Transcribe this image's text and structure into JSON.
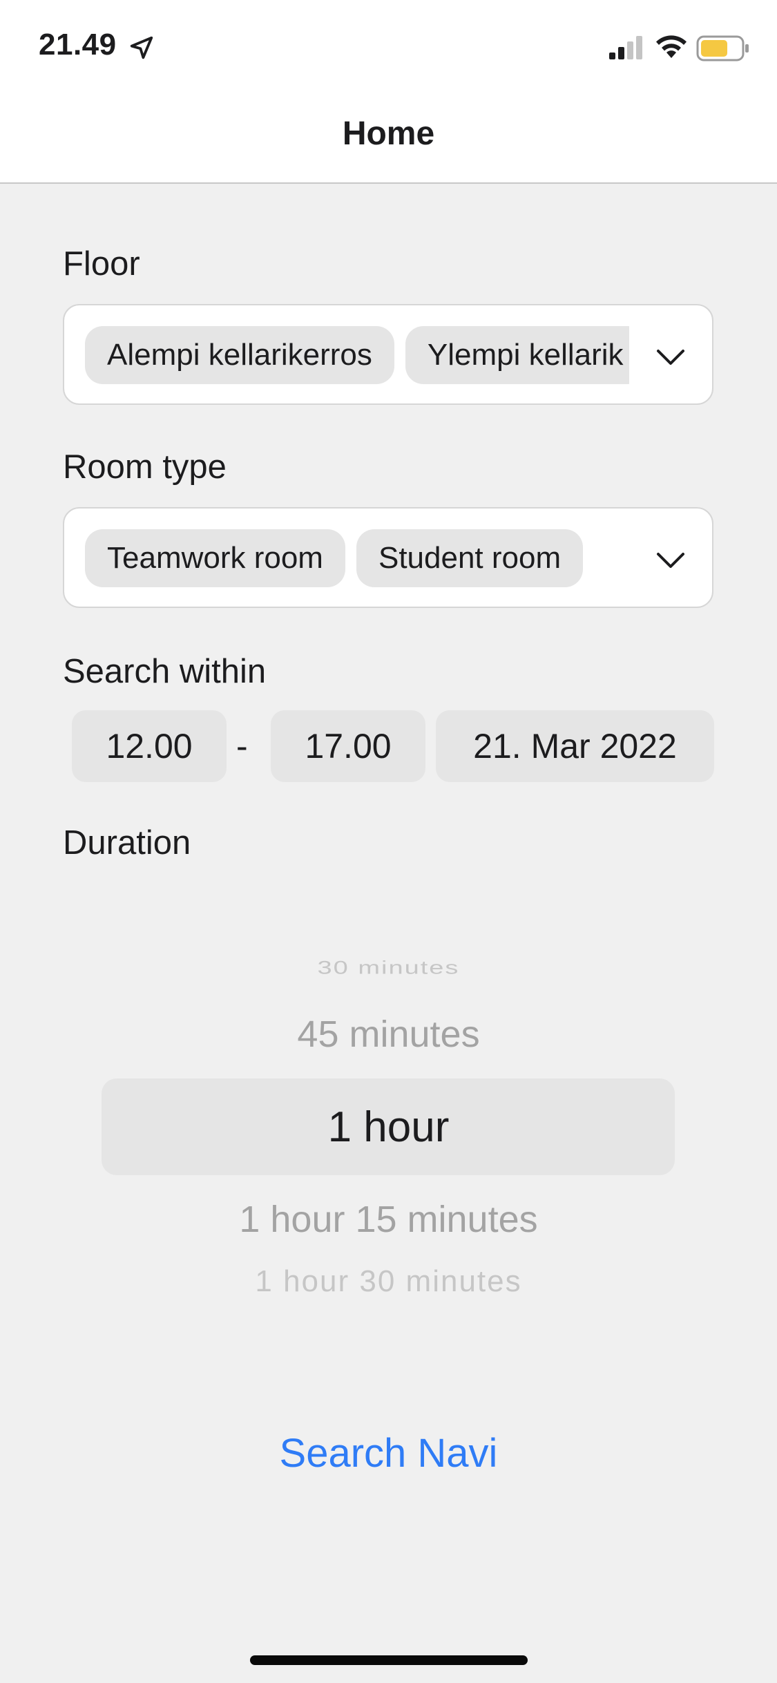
{
  "status_bar": {
    "time": "21.49",
    "battery_color": "#f5c842"
  },
  "header": {
    "title": "Home"
  },
  "floor": {
    "label": "Floor",
    "chips": [
      "Alempi kellarikerros",
      "Ylempi kellarik"
    ]
  },
  "room_type": {
    "label": "Room type",
    "chips": [
      "Teamwork room",
      "Student room"
    ]
  },
  "search_within": {
    "label": "Search within",
    "start_time": "12.00",
    "separator": "-",
    "end_time": "17.00",
    "date": "21. Mar 2022"
  },
  "duration": {
    "label": "Duration",
    "options": [
      "30 minutes",
      "45 minutes",
      "1 hour",
      "1 hour 15 minutes",
      "1 hour 30 minutes"
    ],
    "selected": "1 hour"
  },
  "actions": {
    "search_label": "Search Navi",
    "accent_color": "#2f7cf6"
  }
}
